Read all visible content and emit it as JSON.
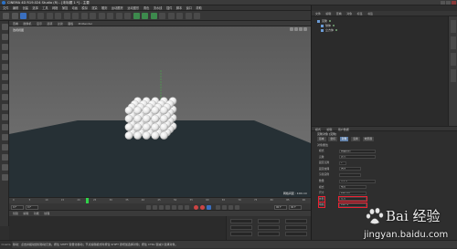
{
  "window": {
    "title": "CINEMA 4D R19.024 Studio (R) - [未标题 1 *] - 主要"
  },
  "menubar": {
    "items": [
      "文件",
      "编辑",
      "创建",
      "选择",
      "工具",
      "网格",
      "捕捉",
      "动画",
      "模拟",
      "渲染",
      "雕刻",
      "运动跟踪",
      "运动图形",
      "角色",
      "流水线",
      "插件",
      "脚本",
      "窗口",
      "帮助"
    ]
  },
  "viewport": {
    "menu": [
      "查看",
      "摄像机",
      "显示",
      "选项",
      "过滤",
      "面板",
      "ProRender"
    ],
    "label": "透视视图",
    "footer": "网格间距 : 100 cm"
  },
  "timeline": {
    "ticks": [
      "0",
      "5",
      "10",
      "15",
      "20",
      "25",
      "30",
      "35",
      "40",
      "45",
      "50",
      "55",
      "60",
      "65",
      "70",
      "75",
      "80",
      "85",
      "90"
    ],
    "current_frame": "0 F"
  },
  "transport": {
    "start": "0 F",
    "current": "0 F",
    "end": "90 F",
    "end2": "90 F"
  },
  "material_bar": {
    "items": [
      "创建",
      "编辑",
      "功能",
      "纹理"
    ]
  },
  "status": {
    "text": "移动：点击并拖动鼠标移动元素。按住 SHIFT 键量化移动；节点编辑模式时按住 SHIFT 键增加选择对象；按住 CTRL 键减少选择对象。",
    "version": "Cinema"
  },
  "object_manager": {
    "menu": [
      "文件",
      "编辑",
      "查看",
      "对象",
      "标签",
      "书签"
    ],
    "objects": [
      {
        "name": "克隆"
      },
      {
        "name": "球体"
      },
      {
        "name": "立方体"
      }
    ]
  },
  "attributes": {
    "menu": [
      "模式",
      "编辑",
      "用户数据"
    ],
    "title": "克隆对象 [克隆]",
    "tabs": [
      "基本",
      "坐标",
      "对象",
      "变换",
      "效果器"
    ],
    "active_tab": "对象",
    "section": "对象属性",
    "props": [
      {
        "label": "模式",
        "value": "网格排列"
      },
      {
        "label": "克隆",
        "value": "迭代"
      },
      {
        "label": "固定克隆",
        "value": "✓"
      },
      {
        "label": "固定纹理",
        "value": "关闭"
      },
      {
        "label": "渲染实例",
        "value": ""
      },
      {
        "label": "数量",
        "value": "3   3   3"
      },
      {
        "label": "模式",
        "value": "端点"
      },
      {
        "label": "尺寸",
        "value": "200 cm"
      },
      {
        "label": "外形",
        "value": "立方"
      },
      {
        "label": "填充",
        "value": "100 %"
      }
    ]
  },
  "watermark": {
    "brand": "Bai 经验",
    "url": "jingyan.baidu.com"
  }
}
